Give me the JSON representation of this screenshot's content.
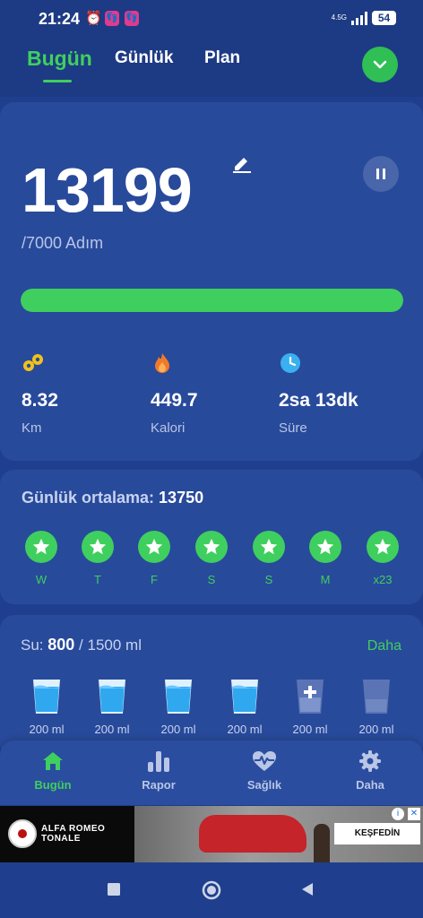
{
  "status_bar": {
    "time": "21:24",
    "network_label": "4.5G",
    "battery": "54"
  },
  "tabs": {
    "today": "Bugün",
    "daily": "Günlük",
    "plan": "Plan"
  },
  "steps": {
    "value": "13199",
    "goal": "/7000 Adım",
    "progress_fraction": 1.0
  },
  "stats": [
    {
      "value": "8.32",
      "label": "Km",
      "icon": "distance-icon"
    },
    {
      "value": "449.7",
      "label": "Kalori",
      "icon": "flame-icon"
    },
    {
      "value": "2sa 13dk",
      "label": "Süre",
      "icon": "clock-icon"
    }
  ],
  "average": {
    "label": "Günlük ortalama:",
    "value": "13750",
    "days": [
      "W",
      "T",
      "F",
      "S",
      "S",
      "M",
      "x23"
    ]
  },
  "water": {
    "label": "Su:",
    "current": "800",
    "total": "/ 1500 ml",
    "more": "Daha",
    "cups": [
      {
        "label": "200 ml",
        "state": "full"
      },
      {
        "label": "200 ml",
        "state": "full"
      },
      {
        "label": "200 ml",
        "state": "full"
      },
      {
        "label": "200 ml",
        "state": "full"
      },
      {
        "label": "200 ml",
        "state": "add"
      },
      {
        "label": "200 ml",
        "state": "empty"
      }
    ]
  },
  "bottom_nav": {
    "home": "Bugün",
    "report": "Rapor",
    "health": "Sağlık",
    "more": "Daha"
  },
  "ad": {
    "brand_line1": "ALFA ROMEO",
    "brand_line2": "TONALE",
    "cta": "KEŞFEDİN"
  },
  "colors": {
    "accent": "#3fcf5e",
    "background": "#1f3f8e",
    "card": "#284a9b"
  }
}
